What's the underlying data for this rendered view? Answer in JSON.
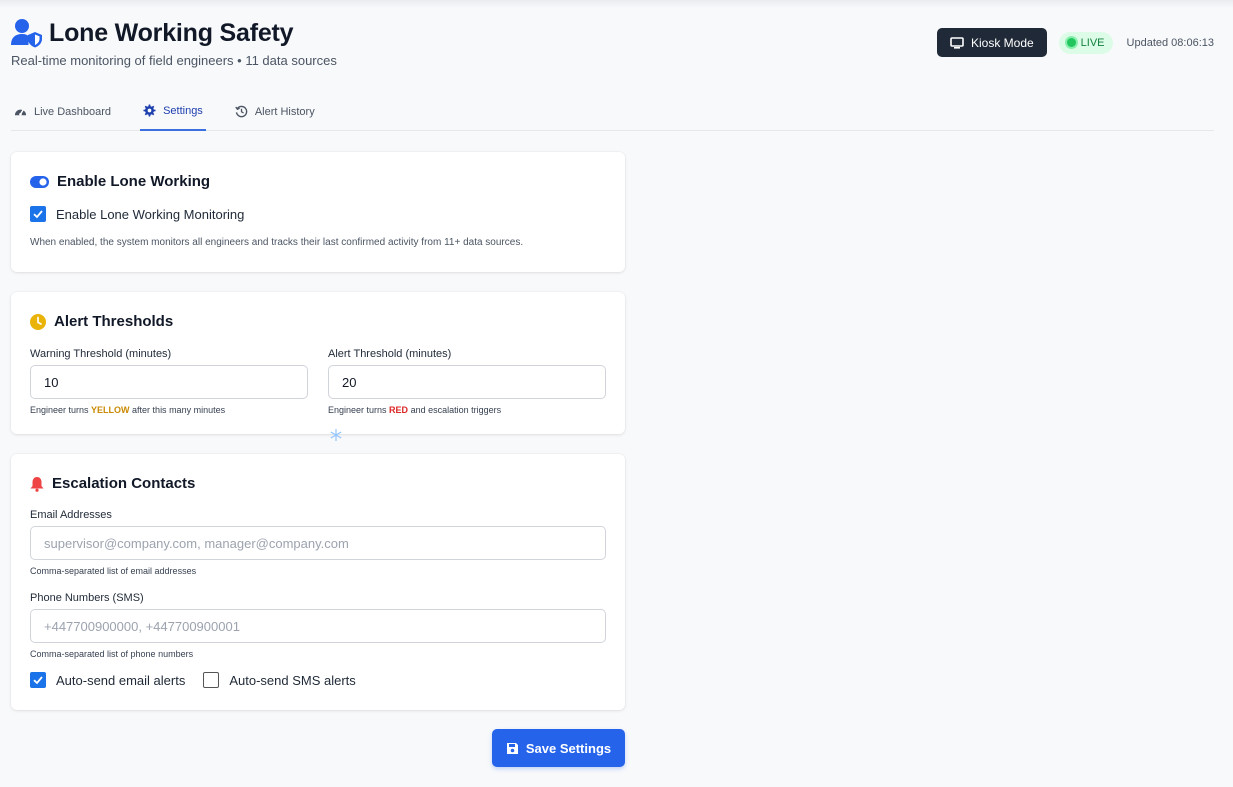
{
  "header": {
    "title": "Lone Working Safety",
    "subtitle": "Real-time monitoring of field engineers • 11 data sources",
    "kiosk_label": "Kiosk Mode",
    "live_label": "LIVE",
    "updated_text": "Updated 08:06:13"
  },
  "tabs": [
    {
      "label": "Live Dashboard",
      "icon": "gauge-icon",
      "active": false
    },
    {
      "label": "Settings",
      "icon": "gear-icon",
      "active": true
    },
    {
      "label": "Alert History",
      "icon": "history-icon",
      "active": false
    }
  ],
  "lone_working": {
    "title": "Enable Lone Working",
    "checkbox_label": "Enable Lone Working Monitoring",
    "checked": true,
    "help": "When enabled, the system monitors all engineers and tracks their last confirmed activity from 11+ data sources."
  },
  "thresholds": {
    "title": "Alert Thresholds",
    "warning_label": "Warning Threshold (minutes)",
    "warning_value": "10",
    "warning_help_pre": "Engineer turns ",
    "warning_help_color": "YELLOW",
    "warning_help_post": " after this many minutes",
    "alert_label": "Alert Threshold (minutes)",
    "alert_value": "20",
    "alert_help_pre": "Engineer turns ",
    "alert_help_color": "RED",
    "alert_help_post": " and escalation triggers"
  },
  "escalation": {
    "title": "Escalation Contacts",
    "email_label": "Email Addresses",
    "email_placeholder": "supervisor@company.com, manager@company.com",
    "email_help": "Comma-separated list of email addresses",
    "phone_label": "Phone Numbers (SMS)",
    "phone_placeholder": "+447700900000, +447700900001",
    "phone_help": "Comma-separated list of phone numbers",
    "auto_email_label": "Auto-send email alerts",
    "auto_email_checked": true,
    "auto_sms_label": "Auto-send SMS alerts",
    "auto_sms_checked": false
  },
  "save_label": "Save Settings",
  "colors": {
    "accent": "#2563eb",
    "dark_button": "#1f2937",
    "live_green": "#22c55e",
    "warning_yellow": "#ca8a04",
    "alert_red": "#dc2626"
  }
}
